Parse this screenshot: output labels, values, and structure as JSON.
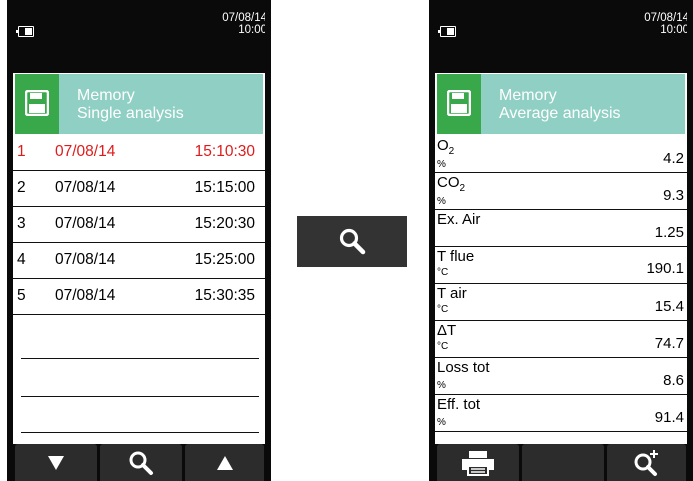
{
  "status": {
    "date": "07/08/14",
    "time": "10:00"
  },
  "left_screen": {
    "header": {
      "title": "Memory",
      "subtitle": "Single analysis",
      "icon": "floppy-disk-icon"
    },
    "rows": [
      {
        "num": "1",
        "date": "07/08/14",
        "time": "15:10:30",
        "selected": true
      },
      {
        "num": "2",
        "date": "07/08/14",
        "time": "15:15:00"
      },
      {
        "num": "3",
        "date": "07/08/14",
        "time": "15:20:30"
      },
      {
        "num": "4",
        "date": "07/08/14",
        "time": "15:25:00"
      },
      {
        "num": "5",
        "date": "07/08/14",
        "time": "15:30:35"
      }
    ],
    "softkeys": [
      "down-arrow-icon",
      "search-icon",
      "up-arrow-icon"
    ]
  },
  "middle_button": {
    "icon": "search-icon"
  },
  "right_screen": {
    "header": {
      "title": "Memory",
      "subtitle": "Average analysis",
      "icon": "floppy-disk-icon"
    },
    "measurements": [
      {
        "label": "O",
        "sub": "2",
        "unit": "%",
        "value": "4.2"
      },
      {
        "label": "CO",
        "sub": "2",
        "unit": "%",
        "value": "9.3"
      },
      {
        "label": "Ex. Air",
        "sub": "",
        "unit": "",
        "value": "1.25"
      },
      {
        "label": "T flue",
        "sub": "",
        "unit": "°C",
        "value": "190.1"
      },
      {
        "label": "T air",
        "sub": "",
        "unit": "°C",
        "value": "15.4"
      },
      {
        "label": "ΔT",
        "sub": "",
        "unit": "°C",
        "value": "74.7"
      },
      {
        "label": "Loss tot",
        "sub": "",
        "unit": "%",
        "value": "8.6"
      },
      {
        "label": "Eff. tot",
        "sub": "",
        "unit": "%",
        "value": "91.4"
      }
    ],
    "softkeys": [
      "printer-icon",
      "",
      "zoom-in-icon"
    ]
  },
  "colors": {
    "accent_green": "#39a84a",
    "header_teal": "#8fcfc4",
    "selected_red": "#e01a1a",
    "device_black": "#0a0a0a"
  }
}
